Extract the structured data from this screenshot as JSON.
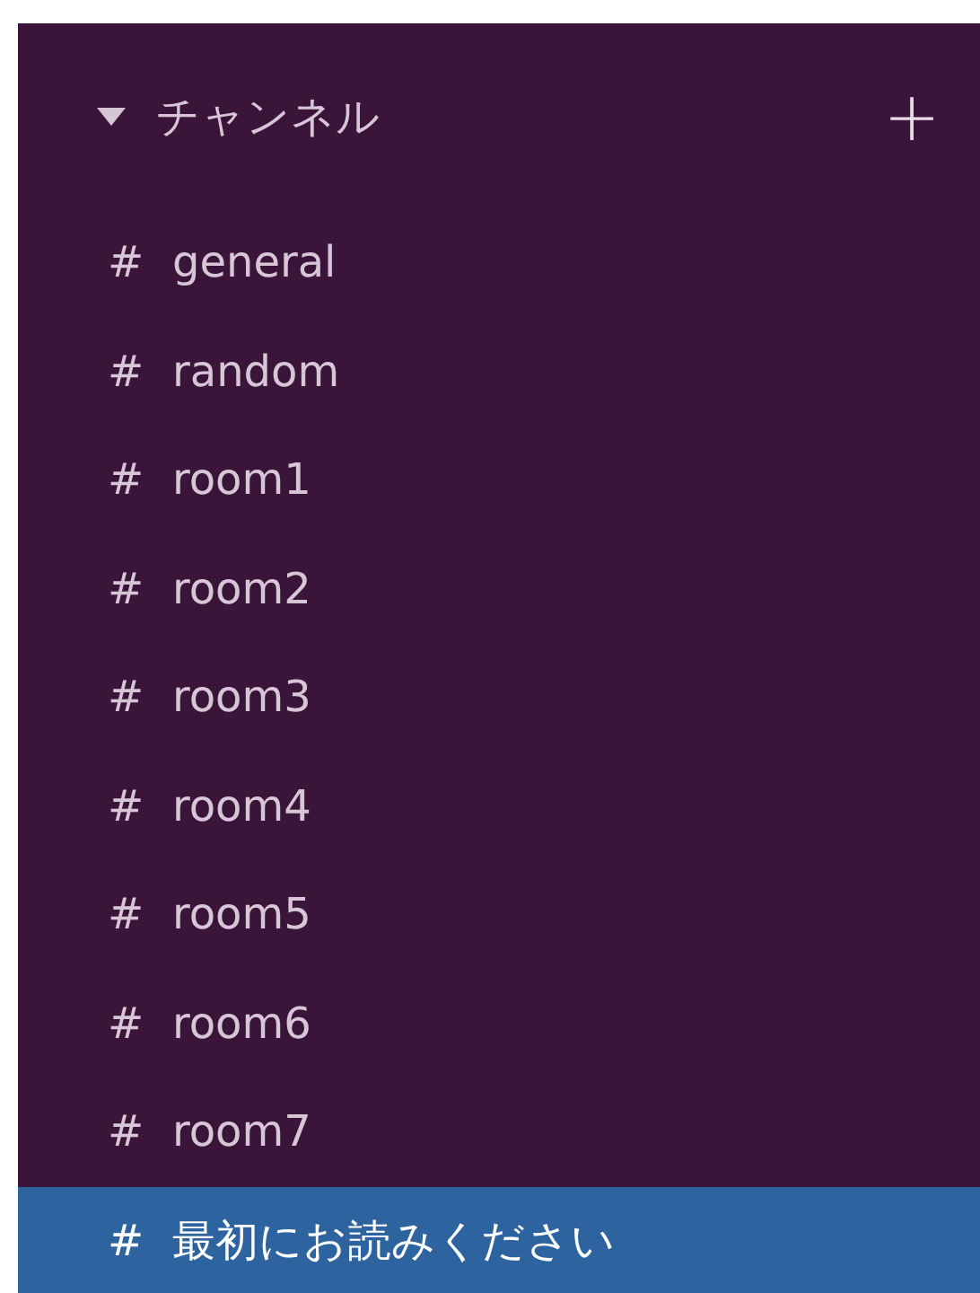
{
  "section": {
    "title": "チャンネル",
    "expanded": true,
    "add_symbol": "+"
  },
  "channels": [
    {
      "hash": "#",
      "name": "general",
      "selected": false
    },
    {
      "hash": "#",
      "name": "random",
      "selected": false
    },
    {
      "hash": "#",
      "name": "room1",
      "selected": false
    },
    {
      "hash": "#",
      "name": "room2",
      "selected": false
    },
    {
      "hash": "#",
      "name": "room3",
      "selected": false
    },
    {
      "hash": "#",
      "name": "room4",
      "selected": false
    },
    {
      "hash": "#",
      "name": "room5",
      "selected": false
    },
    {
      "hash": "#",
      "name": "room6",
      "selected": false
    },
    {
      "hash": "#",
      "name": "room7",
      "selected": false
    },
    {
      "hash": "#",
      "name": "最初にお読みください",
      "selected": true
    }
  ]
}
